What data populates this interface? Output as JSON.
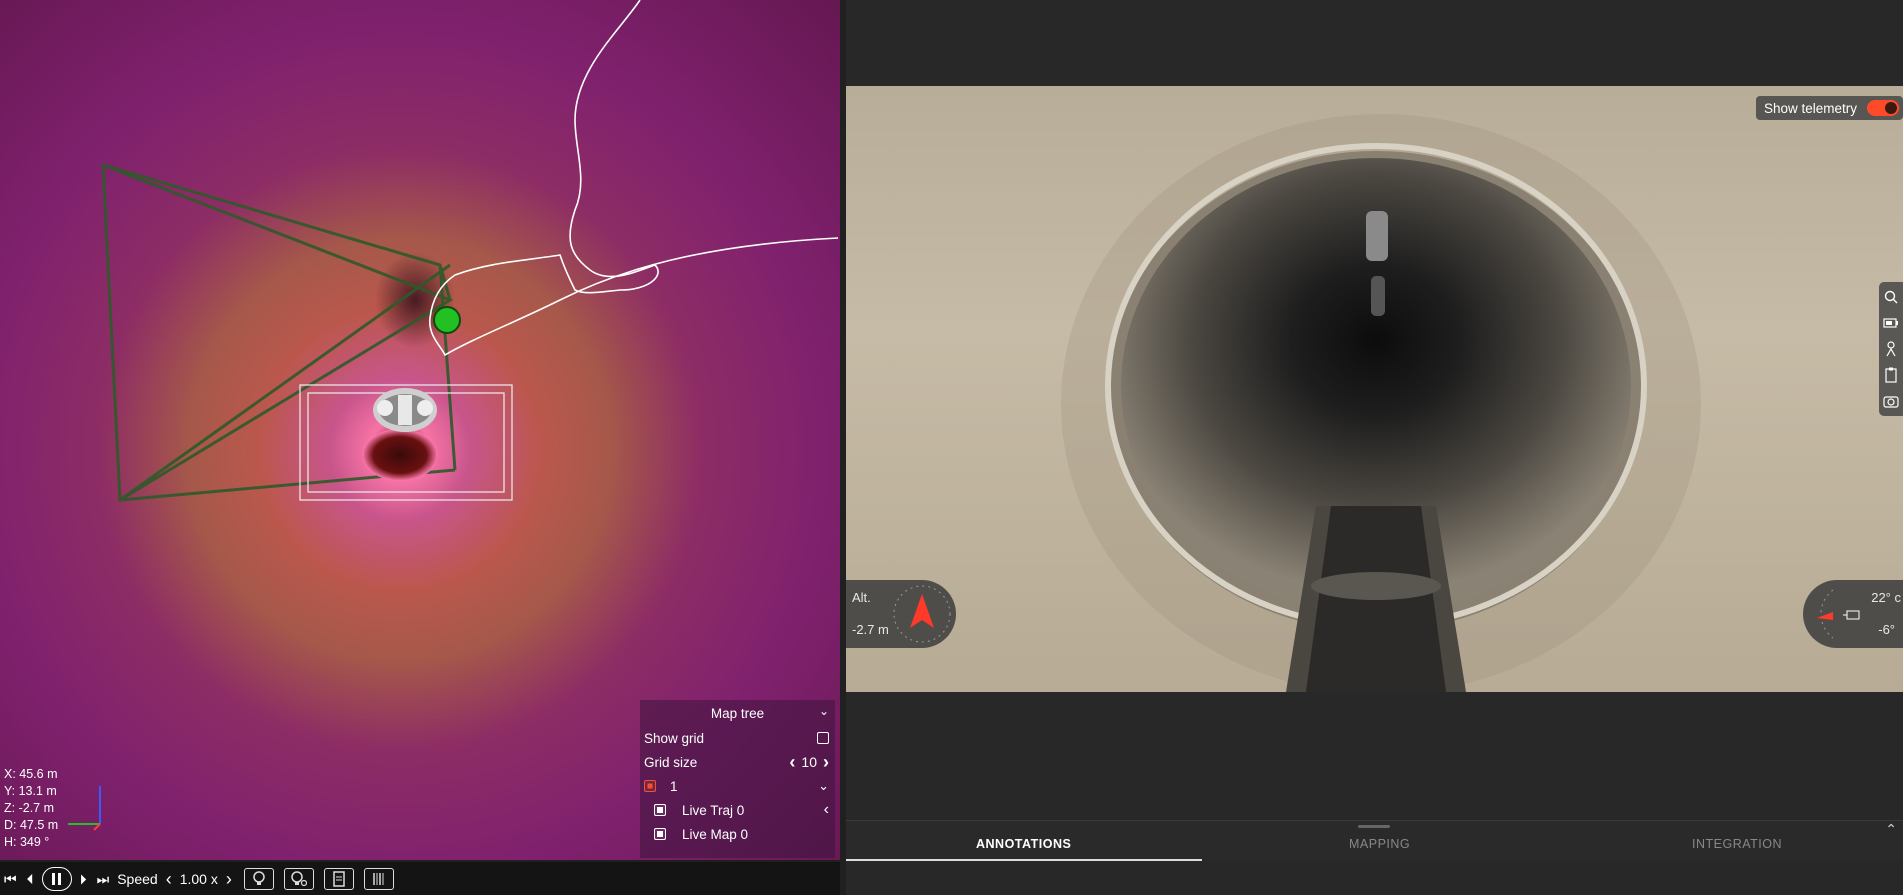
{
  "map": {
    "coords": [
      "X: 45.6 m",
      "Y: 13.1 m",
      "Z: -2.7 m",
      "D: 47.5 m",
      "H: 349 °"
    ],
    "map_tree": {
      "title": "Map tree",
      "show_grid_label": "Show grid",
      "grid_size_label": "Grid size",
      "grid_size_value": "10",
      "layer_1_label": "1",
      "live_traj_label": "Live Traj 0",
      "live_map_label": "Live Map 0"
    },
    "colors": {
      "trajectory": "#ffffff",
      "frustum": "#2e5a2a",
      "marker": "#22c022"
    }
  },
  "playback": {
    "speed_label": "Speed",
    "speed_value": "1.00 x",
    "icons": [
      "skip-back-icon",
      "step-back-icon",
      "pause-icon",
      "step-forward-icon",
      "skip-forward-icon"
    ],
    "tools": [
      "bulb-icon",
      "bulb-settings-icon",
      "document-icon",
      "barcode-icon"
    ]
  },
  "camera": {
    "show_telemetry_label": "Show telemetry",
    "show_telemetry_on": true,
    "altitude_label": "Alt.",
    "altitude_value": "-2.7 m",
    "temperature_value": "22° c",
    "tilt_value": "-6°",
    "side_tools": [
      "zoom-icon",
      "battery-icon",
      "diver-icon",
      "clipboard-icon",
      "camera-icon"
    ]
  },
  "tabs": [
    {
      "label": "ANNOTATIONS",
      "active": true
    },
    {
      "label": "MAPPING",
      "active": false
    },
    {
      "label": "INTEGRATION",
      "active": false
    }
  ]
}
